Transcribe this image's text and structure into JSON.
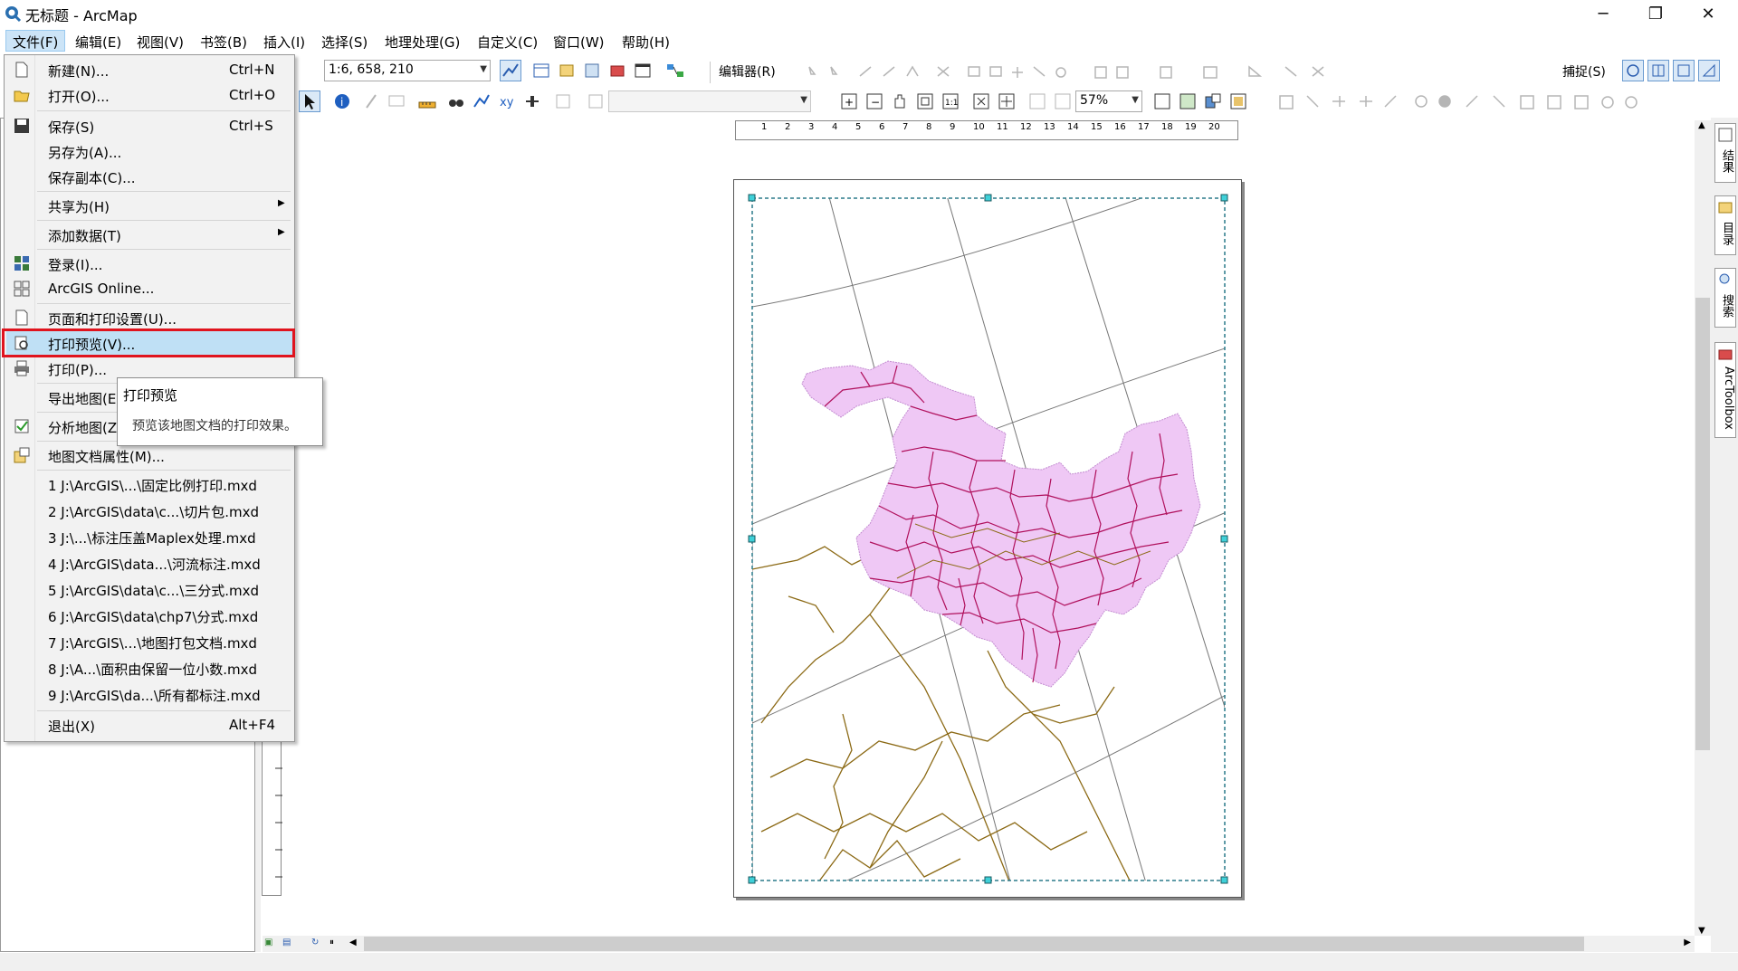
{
  "window": {
    "title": "无标题 - ArcMap",
    "minimize_icon": "─",
    "restore_icon": "❐",
    "close_icon": "✕"
  },
  "menubar": [
    {
      "label": "文件(F)",
      "active": true
    },
    {
      "label": "编辑(E)"
    },
    {
      "label": "视图(V)"
    },
    {
      "label": "书签(B)"
    },
    {
      "label": "插入(I)"
    },
    {
      "label": "选择(S)"
    },
    {
      "label": "地理处理(G)"
    },
    {
      "label": "自定义(C)"
    },
    {
      "label": "窗口(W)"
    },
    {
      "label": "帮助(H)"
    }
  ],
  "toolbar": {
    "scale_value": "1:6, 658, 210",
    "editor_label": "编辑器(R)",
    "snap_label": "捕捉(S)",
    "zoom_value": "57%"
  },
  "ruler": {
    "ticks": [
      "1",
      "2",
      "3",
      "4",
      "5",
      "6",
      "7",
      "8",
      "9",
      "10",
      "11",
      "12",
      "13",
      "14",
      "15",
      "16",
      "17",
      "18",
      "19",
      "20"
    ]
  },
  "file_menu": {
    "items": [
      {
        "label": "新建(N)...",
        "shortcut": "Ctrl+N",
        "icon": "new-document-icon"
      },
      {
        "label": "打开(O)...",
        "shortcut": "Ctrl+O",
        "icon": "open-folder-icon"
      },
      {
        "label": "保存(S)",
        "shortcut": "Ctrl+S",
        "icon": "save-icon"
      },
      {
        "label": "另存为(A)..."
      },
      {
        "label": "保存副本(C)..."
      },
      {
        "label": "共享为(H)",
        "submenu": true
      },
      {
        "label": "添加数据(T)",
        "submenu": true
      },
      {
        "label": "登录(I)...",
        "icon": "sign-in-icon"
      },
      {
        "label": "ArcGIS Online...",
        "icon": "arcgis-online-icon"
      },
      {
        "label": "页面和打印设置(U)...",
        "icon": "page-setup-icon"
      },
      {
        "label": "打印预览(V)...",
        "icon": "print-preview-icon",
        "highlighted": true
      },
      {
        "label": "打印(P)...",
        "icon": "print-icon"
      },
      {
        "label": "导出地图(E)..."
      },
      {
        "label": "分析地图(Z)...",
        "icon": "analyze-map-icon"
      },
      {
        "label": "地图文档属性(M)...",
        "icon": "document-properties-icon"
      },
      {
        "label": "1 J:\\ArcGIS\\...\\固定比例打印.mxd"
      },
      {
        "label": "2 J:\\ArcGIS\\data\\c...\\切片包.mxd"
      },
      {
        "label": "3 J:\\...\\标注压盖Maplex处理.mxd"
      },
      {
        "label": "4 J:\\ArcGIS\\data...\\河流标注.mxd"
      },
      {
        "label": "5 J:\\ArcGIS\\data\\c...\\三分式.mxd"
      },
      {
        "label": "6 J:\\ArcGIS\\data\\chp7\\分式.mxd"
      },
      {
        "label": "7 J:\\ArcGIS\\...\\地图打包文档.mxd"
      },
      {
        "label": "8 J:\\A...\\面积由保留一位小数.mxd"
      },
      {
        "label": "9 J:\\ArcGIS\\da...\\所有都标注.mxd"
      },
      {
        "label": "退出(X)",
        "shortcut": "Alt+F4"
      }
    ]
  },
  "tooltip": {
    "title": "打印预览",
    "description": "预览该地图文档的打印效果。"
  },
  "right_dock": {
    "tabs": [
      "结果",
      "目录",
      "搜索",
      "ArcToolbox"
    ]
  },
  "colors": {
    "highlight_box": "#e0141e",
    "menu_highlight": "#bfe0f5",
    "map_fill": "#efc8f5",
    "boundary": "#b0105c",
    "rivers": "#8b6914"
  }
}
